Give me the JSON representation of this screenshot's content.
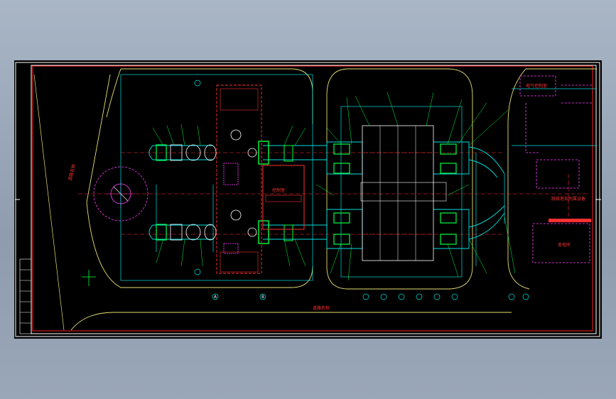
{
  "drawing": {
    "labels": {
      "road_left": "道路名称",
      "road_bottom": "道路名称",
      "building_center": "控制室",
      "building_right_top": "电气控制室",
      "building_right_mid": "脱硫塔及附属设备",
      "building_right_bottom": "变电所",
      "grid_a": "A",
      "grid_b": "B"
    },
    "colors": {
      "background": "#000000",
      "frame": "#ffffff",
      "border_red": "#ff2020",
      "duct_cyan": "#00e0e0",
      "pipe_green": "#00ff40",
      "magenta": "#ff40ff",
      "yellow": "#e8e070",
      "red_text": "#ff3030"
    },
    "icons": [
      "compass-icon"
    ]
  }
}
